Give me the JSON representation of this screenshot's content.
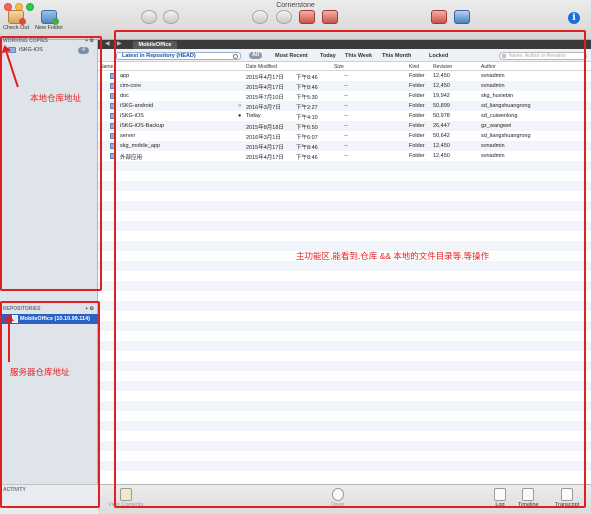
{
  "window": {
    "title": "Cornerstone"
  },
  "toolbar": {
    "checkout_label": "Check Out",
    "new_folder_label": "New Folder",
    "info_glyph": "i"
  },
  "sidebar": {
    "working_copies_header": "WORKING COPIES",
    "working_copies_actions": "+ ⚙",
    "working_copy": {
      "name": "iSKG-iOS",
      "badge": "4"
    },
    "repositories_header": "REPOSITORIES",
    "repositories_actions": "+ ⚙",
    "repository": {
      "name": "MobileOffice (10.10.99.114)"
    },
    "activity_header": "ACTIVITY"
  },
  "tabs": {
    "active": "MobileOffice",
    "back": "◀",
    "forward": "▶"
  },
  "filterbar": {
    "revision": "Latest in Repository (HEAD)",
    "filters": [
      "All",
      "Most Recent",
      "Today",
      "This Week",
      "This Month",
      "Locked"
    ],
    "search_placeholder": "Name, Author or Revision"
  },
  "columns": {
    "name": "Name",
    "date": "Date Modified",
    "size": "Size",
    "kind": "Kind",
    "revision": "Revision",
    "author": "Author"
  },
  "files": [
    {
      "name": "app",
      "date": "2015年4月17日",
      "time": "下午8:46",
      "size": "--",
      "kind": "Folder",
      "revision": "12,450",
      "author": "svnadmin",
      "status": ""
    },
    {
      "name": "cim-core",
      "date": "2015年4月17日",
      "time": "下午8:46",
      "size": "--",
      "kind": "Folder",
      "revision": "12,450",
      "author": "svnadmin",
      "status": ""
    },
    {
      "name": "doc",
      "date": "2015年7月10日",
      "time": "下午5:30",
      "size": "--",
      "kind": "Folder",
      "revision": "19,942",
      "author": "skg_huxiebin",
      "status": ""
    },
    {
      "name": "iSKG-android",
      "date": "2016年3月7日",
      "time": "下午2:27",
      "size": "--",
      "kind": "Folder",
      "revision": "50,899",
      "author": "sd_liangshuangrong",
      "status": "○"
    },
    {
      "name": "iSKG-iOS",
      "date": "Today",
      "time": "下午4:10",
      "size": "--",
      "kind": "Folder",
      "revision": "50,978",
      "author": "sd_cuiwenlong",
      "status": "●"
    },
    {
      "name": "iSKG-iOS-Backup",
      "date": "2015年8月18日",
      "time": "下午6:50",
      "size": "--",
      "kind": "Folder",
      "revision": "26,447",
      "author": "gz_wangwei",
      "status": ""
    },
    {
      "name": "server",
      "date": "2016年3月1日",
      "time": "下午6:07",
      "size": "--",
      "kind": "Folder",
      "revision": "50,642",
      "author": "sd_liangshuangrong",
      "status": ""
    },
    {
      "name": "skg_mobile_app",
      "date": "2015年4月17日",
      "time": "下午8:46",
      "size": "--",
      "kind": "Folder",
      "revision": "12,450",
      "author": "svnadmin",
      "status": ""
    },
    {
      "name": "外部应用",
      "date": "2015年4月17日",
      "time": "下午8:46",
      "size": "--",
      "kind": "Folder",
      "revision": "12,450",
      "author": "svnadmin",
      "status": ""
    }
  ],
  "annotations": {
    "local": "本地仓库地址",
    "server": "服务器仓库地址",
    "main": "主功能区,能看到,仓库 && 本地的文件目录等.等操作"
  },
  "bottombar": {
    "contents_label": "View Contents",
    "open_label": "Open",
    "log_label": "Log",
    "timeline_label": "Timeline",
    "transcript_label": "Transcript"
  },
  "colors": {
    "annotation": "#e02020",
    "selection": "#2962c4",
    "tab_bar": "#3b3b3b"
  }
}
